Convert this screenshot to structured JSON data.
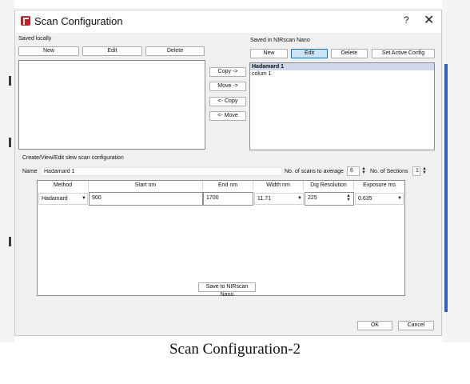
{
  "window": {
    "title": "Scan Configuration",
    "help_glyph": "?",
    "close_glyph": "✕"
  },
  "saved_locally": {
    "label": "Saved locally",
    "buttons": {
      "new": "New",
      "edit": "Edit",
      "delete": "Delete"
    }
  },
  "transfer": {
    "copy_to": "Copy ->",
    "move_to": "Move ->",
    "copy_from": "<- Copy",
    "move_from": "<- Move"
  },
  "saved_device": {
    "label": "Saved in NIRscan Nano",
    "buttons": {
      "new": "New",
      "edit": "Edit",
      "delete": "Delete",
      "set_active": "Set Active Config"
    },
    "items": [
      "Hadamard 1",
      "colum 1"
    ]
  },
  "editor": {
    "section_label": "Create/View/Edit  slew scan configuration",
    "name_label": "Name",
    "name_value": "Hadamard 1",
    "scans_avg_label": "No. of scans to average",
    "scans_avg_value": "6",
    "sections_label": "No. of Sections",
    "sections_value": "1",
    "columns": [
      "Method",
      "Start nm",
      "End nm",
      "Width nm",
      "Dig Resolution",
      "Exposure ms"
    ],
    "row": {
      "method": "Hadamard",
      "start": "900",
      "end": "1700",
      "width": "11.71",
      "resolution": "225",
      "exposure": "0.635"
    }
  },
  "save_button": "Save to NIRscan Nano",
  "ok": "OK",
  "cancel": "Cancel",
  "caption": "Scan Configuration-2",
  "colors": {
    "accent": "#0078d7",
    "selection": "#cdd9ea",
    "icon": "#c4202a",
    "screen_strip": "#2f5fbf"
  },
  "icons": [
    "app-icon",
    "help-icon",
    "close-icon",
    "dropdown-arrow-icon",
    "spinner-icon"
  ]
}
